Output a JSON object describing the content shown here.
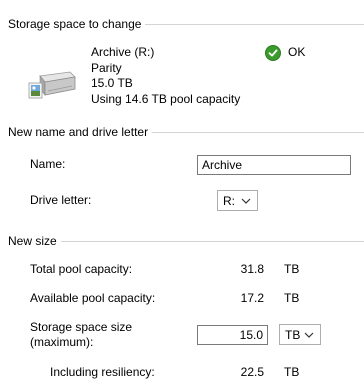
{
  "storage_section": {
    "title": "Storage space to change",
    "drive_name": "Archive (R:)",
    "resiliency": "Parity",
    "size": "15.0 TB",
    "usage": "Using 14.6 TB pool capacity",
    "status": "OK",
    "status_color": "#3a9b2d"
  },
  "name_section": {
    "title": "New name and drive letter",
    "name_label": "Name:",
    "name_value": "Archive",
    "drive_letter_label": "Drive letter:",
    "drive_letter_value": "R:"
  },
  "size_section": {
    "title": "New size",
    "total_label": "Total pool capacity:",
    "total_value": "31.8",
    "total_unit": "TB",
    "available_label": "Available pool capacity:",
    "available_value": "17.2",
    "available_unit": "TB",
    "size_label_line1": "Storage space size",
    "size_label_line2": "(maximum):",
    "size_value": "15.0",
    "size_unit": "TB",
    "resiliency_label": "Including resiliency:",
    "resiliency_value": "22.5",
    "resiliency_unit": "TB"
  },
  "icons": {
    "drive": "drive-icon",
    "status": "check-circle-icon",
    "dropdown": "chevron-down-icon"
  }
}
